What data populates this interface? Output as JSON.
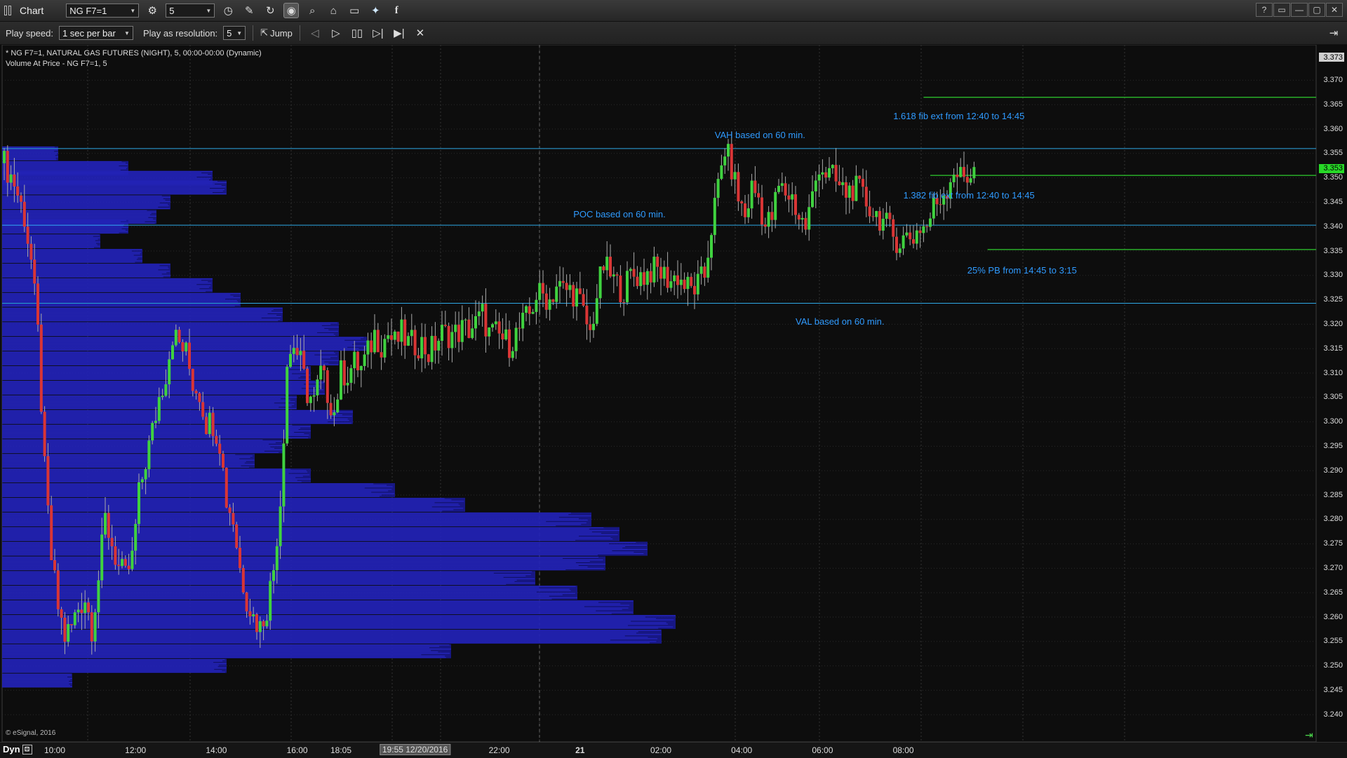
{
  "titlebar": {
    "title": "Chart",
    "symbol": "NG F7=1",
    "interval": "5",
    "icons": [
      "symbol-link-icon",
      "interval-clock-icon",
      "pencil-icon",
      "refresh-icon",
      "play-mode-icon",
      "search-icon",
      "bookmark-icon",
      "comment-icon",
      "twitter-icon",
      "facebook-icon"
    ],
    "window_controls": [
      "?",
      "▭",
      "—",
      "▢",
      "✕"
    ]
  },
  "playbar": {
    "speed_label": "Play speed:",
    "speed_value": "1 sec per bar",
    "resolution_label": "Play as resolution:",
    "resolution_value": "5",
    "jump_label": "Jump"
  },
  "chart_info": {
    "line1": "* NG F7=1, NATURAL GAS FUTURES (NIGHT), 5, 00:00-00:00 (Dynamic)",
    "line2": "Volume At Price - NG F7=1, 5",
    "copyright": "© eSignal, 2016"
  },
  "bottombar": {
    "mode": "Dyn",
    "time_labels": [
      {
        "text": "10:00",
        "idx": 15,
        "hl": false
      },
      {
        "text": "12:00",
        "idx": 39,
        "hl": false
      },
      {
        "text": "14:00",
        "idx": 63,
        "hl": false
      },
      {
        "text": "16:00",
        "idx": 87,
        "hl": false
      },
      {
        "text": "18:05",
        "idx": 100,
        "hl": false
      },
      {
        "text": "19:55 12/20/2016",
        "idx": 122,
        "hl": true
      },
      {
        "text": "22:00",
        "idx": 147,
        "hl": false
      },
      {
        "text": "21",
        "idx": 171,
        "hl": false
      },
      {
        "text": "02:00",
        "idx": 195,
        "hl": false
      },
      {
        "text": "04:00",
        "idx": 219,
        "hl": false
      },
      {
        "text": "06:00",
        "idx": 243,
        "hl": false
      },
      {
        "text": "08:00",
        "idx": 267,
        "hl": false
      }
    ]
  },
  "annotations": [
    {
      "text": "VAH based on 60 min.",
      "x_idx": 211,
      "price": 3.3587
    },
    {
      "text": "POC based on 60 min.",
      "x_idx": 169,
      "price": 3.3425
    },
    {
      "text": "VAL based on 60 min.",
      "x_idx": 235,
      "price": 3.3205
    },
    {
      "text": "1.618 fib ext from 12:40 to 14:45",
      "x_idx": 264,
      "price": 3.3626
    },
    {
      "text": "1.382  fib ext from 12:40 to 14:45",
      "x_idx": 267,
      "price": 3.3464
    },
    {
      "text": "25% PB from 14:45 to 3:15",
      "x_idx": 286,
      "price": 3.331
    }
  ],
  "colors": {
    "bull": "#3fd23f",
    "bear": "#d93535",
    "vap": "#1a1a9a",
    "hline": "#2ea8e6",
    "fibline": "#2ecc2e",
    "grid": "#2a2a2a",
    "text": "#dddddd",
    "annot": "#2f9bff"
  },
  "chart_data": {
    "type": "candlestick",
    "symbol": "NG F7=1",
    "interval_minutes": 5,
    "y_range": [
      3.235,
      3.375
    ],
    "y_ticks": [
      3.24,
      3.245,
      3.25,
      3.255,
      3.26,
      3.265,
      3.27,
      3.275,
      3.28,
      3.285,
      3.29,
      3.295,
      3.3,
      3.305,
      3.31,
      3.315,
      3.32,
      3.325,
      3.33,
      3.335,
      3.34,
      3.345,
      3.35,
      3.355,
      3.36,
      3.365,
      3.37
    ],
    "last_price": "3.353",
    "top_price_label": "3.373",
    "horizontal_levels": [
      {
        "name": "VAH",
        "price": 3.356
      },
      {
        "name": "POC",
        "price": 3.3403
      },
      {
        "name": "VAL",
        "price": 3.3243
      }
    ],
    "fib_levels": [
      {
        "name": "1.618 fib ext",
        "price": 3.3665,
        "from_idx": 273
      },
      {
        "name": "1.382 fib ext",
        "price": 3.3505,
        "from_idx": 275
      },
      {
        "name": "25% PB",
        "price": 3.3353,
        "from_idx": 292
      }
    ],
    "candles_summary": "≈272 five-minute bars from ~07:00 12/20 through ~08:20 12/21; open ~3.353, low ~3.255 (around 09:55), rally to ~3.32, drift to ~3.33, spike to ~3.355 near 03:15, then range 3.335–3.355",
    "close_path": [
      [
        0,
        3.353
      ],
      [
        3,
        3.349
      ],
      [
        6,
        3.342
      ],
      [
        8,
        3.333
      ],
      [
        10,
        3.318
      ],
      [
        12,
        3.29
      ],
      [
        14,
        3.272
      ],
      [
        16,
        3.262
      ],
      [
        18,
        3.256
      ],
      [
        20,
        3.258
      ],
      [
        22,
        3.262
      ],
      [
        24,
        3.264
      ],
      [
        26,
        3.258
      ],
      [
        28,
        3.268
      ],
      [
        30,
        3.28
      ],
      [
        32,
        3.275
      ],
      [
        34,
        3.27
      ],
      [
        36,
        3.268
      ],
      [
        38,
        3.272
      ],
      [
        40,
        3.285
      ],
      [
        42,
        3.292
      ],
      [
        44,
        3.298
      ],
      [
        46,
        3.305
      ],
      [
        48,
        3.31
      ],
      [
        50,
        3.318
      ],
      [
        52,
        3.316
      ],
      [
        54,
        3.314
      ],
      [
        56,
        3.308
      ],
      [
        58,
        3.306
      ],
      [
        60,
        3.3
      ],
      [
        62,
        3.3
      ],
      [
        64,
        3.296
      ],
      [
        66,
        3.284
      ],
      [
        68,
        3.28
      ],
      [
        70,
        3.27
      ],
      [
        72,
        3.264
      ],
      [
        74,
        3.26
      ],
      [
        76,
        3.258
      ],
      [
        78,
        3.262
      ],
      [
        80,
        3.27
      ],
      [
        82,
        3.284
      ],
      [
        84,
        3.312
      ],
      [
        86,
        3.316
      ],
      [
        88,
        3.312
      ],
      [
        90,
        3.306
      ],
      [
        92,
        3.304
      ],
      [
        94,
        3.31
      ],
      [
        96,
        3.306
      ],
      [
        98,
        3.302
      ],
      [
        100,
        3.31
      ],
      [
        102,
        3.31
      ],
      [
        104,
        3.312
      ],
      [
        106,
        3.311
      ],
      [
        108,
        3.314
      ],
      [
        110,
        3.318
      ],
      [
        112,
        3.316
      ],
      [
        114,
        3.318
      ],
      [
        116,
        3.316
      ],
      [
        118,
        3.318
      ],
      [
        120,
        3.316
      ],
      [
        122,
        3.316
      ],
      [
        124,
        3.316
      ],
      [
        126,
        3.314
      ],
      [
        128,
        3.316
      ],
      [
        130,
        3.318
      ],
      [
        132,
        3.318
      ],
      [
        134,
        3.318
      ],
      [
        136,
        3.319
      ],
      [
        138,
        3.319
      ],
      [
        140,
        3.32
      ],
      [
        142,
        3.322
      ],
      [
        144,
        3.318
      ],
      [
        146,
        3.318
      ],
      [
        148,
        3.317
      ],
      [
        150,
        3.316
      ],
      [
        152,
        3.318
      ],
      [
        154,
        3.32
      ],
      [
        156,
        3.322
      ],
      [
        158,
        3.326
      ],
      [
        160,
        3.326
      ],
      [
        162,
        3.325
      ],
      [
        164,
        3.328
      ],
      [
        166,
        3.327
      ],
      [
        168,
        3.327
      ],
      [
        170,
        3.326
      ],
      [
        172,
        3.322
      ],
      [
        174,
        3.318
      ],
      [
        176,
        3.326
      ],
      [
        178,
        3.332
      ],
      [
        180,
        3.33
      ],
      [
        182,
        3.328
      ],
      [
        184,
        3.327
      ],
      [
        186,
        3.33
      ],
      [
        188,
        3.33
      ],
      [
        190,
        3.33
      ],
      [
        192,
        3.331
      ],
      [
        194,
        3.331
      ],
      [
        196,
        3.33
      ],
      [
        198,
        3.329
      ],
      [
        200,
        3.33
      ],
      [
        202,
        3.328
      ],
      [
        204,
        3.327
      ],
      [
        206,
        3.328
      ],
      [
        208,
        3.33
      ],
      [
        210,
        3.34
      ],
      [
        212,
        3.348
      ],
      [
        214,
        3.356
      ],
      [
        216,
        3.352
      ],
      [
        218,
        3.346
      ],
      [
        220,
        3.342
      ],
      [
        222,
        3.348
      ],
      [
        224,
        3.346
      ],
      [
        226,
        3.34
      ],
      [
        228,
        3.342
      ],
      [
        230,
        3.348
      ],
      [
        232,
        3.347
      ],
      [
        234,
        3.346
      ],
      [
        236,
        3.342
      ],
      [
        238,
        3.34
      ],
      [
        240,
        3.346
      ],
      [
        242,
        3.353
      ],
      [
        244,
        3.351
      ],
      [
        246,
        3.35
      ],
      [
        248,
        3.348
      ],
      [
        250,
        3.347
      ],
      [
        252,
        3.348
      ],
      [
        254,
        3.347
      ],
      [
        256,
        3.345
      ],
      [
        258,
        3.343
      ],
      [
        260,
        3.342
      ],
      [
        262,
        3.34
      ],
      [
        264,
        3.338
      ],
      [
        266,
        3.337
      ],
      [
        268,
        3.338
      ],
      [
        270,
        3.338
      ],
      [
        272,
        3.34
      ],
      [
        274,
        3.34
      ],
      [
        276,
        3.344
      ],
      [
        278,
        3.346
      ],
      [
        280,
        3.348
      ],
      [
        282,
        3.352
      ],
      [
        284,
        3.35
      ],
      [
        286,
        3.35
      ],
      [
        288,
        3.353
      ]
    ],
    "volume_at_price": [
      {
        "price": 3.355,
        "vol": 40
      },
      {
        "price": 3.352,
        "vol": 90
      },
      {
        "price": 3.35,
        "vol": 150
      },
      {
        "price": 3.348,
        "vol": 160
      },
      {
        "price": 3.345,
        "vol": 120
      },
      {
        "price": 3.342,
        "vol": 110
      },
      {
        "price": 3.34,
        "vol": 90
      },
      {
        "price": 3.337,
        "vol": 70
      },
      {
        "price": 3.334,
        "vol": 100
      },
      {
        "price": 3.331,
        "vol": 120
      },
      {
        "price": 3.328,
        "vol": 150
      },
      {
        "price": 3.325,
        "vol": 170
      },
      {
        "price": 3.322,
        "vol": 200
      },
      {
        "price": 3.319,
        "vol": 240
      },
      {
        "price": 3.316,
        "vol": 260
      },
      {
        "price": 3.313,
        "vol": 240
      },
      {
        "price": 3.31,
        "vol": 220
      },
      {
        "price": 3.307,
        "vol": 230
      },
      {
        "price": 3.304,
        "vol": 210
      },
      {
        "price": 3.301,
        "vol": 250
      },
      {
        "price": 3.298,
        "vol": 220
      },
      {
        "price": 3.295,
        "vol": 200
      },
      {
        "price": 3.292,
        "vol": 180
      },
      {
        "price": 3.289,
        "vol": 220
      },
      {
        "price": 3.286,
        "vol": 280
      },
      {
        "price": 3.283,
        "vol": 330
      },
      {
        "price": 3.28,
        "vol": 420
      },
      {
        "price": 3.277,
        "vol": 440
      },
      {
        "price": 3.274,
        "vol": 460
      },
      {
        "price": 3.271,
        "vol": 430
      },
      {
        "price": 3.268,
        "vol": 380
      },
      {
        "price": 3.265,
        "vol": 410
      },
      {
        "price": 3.262,
        "vol": 450
      },
      {
        "price": 3.259,
        "vol": 480
      },
      {
        "price": 3.256,
        "vol": 470
      },
      {
        "price": 3.253,
        "vol": 320
      },
      {
        "price": 3.25,
        "vol": 160
      },
      {
        "price": 3.247,
        "vol": 50
      }
    ]
  }
}
